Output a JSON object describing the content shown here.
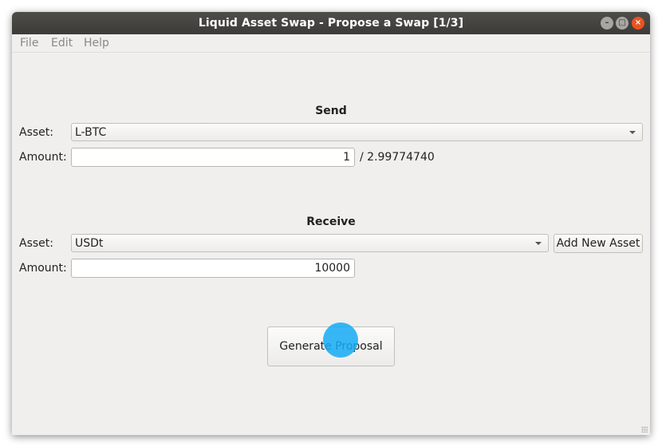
{
  "window": {
    "title": "Liquid Asset Swap - Propose a Swap [1/3]",
    "controls": {
      "minimize": "–",
      "maximize": "□",
      "close": "×"
    }
  },
  "menu": {
    "items": [
      "File",
      "Edit",
      "Help"
    ]
  },
  "send": {
    "heading": "Send",
    "asset_label": "Asset:",
    "asset_value": "L-BTC",
    "amount_label": "Amount:",
    "amount_value": "1",
    "balance": "/ 2.99774740"
  },
  "receive": {
    "heading": "Receive",
    "asset_label": "Asset:",
    "asset_value": "USDt",
    "add_asset_button": "Add New Asset",
    "amount_label": "Amount:",
    "amount_value": "10000"
  },
  "actions": {
    "generate_button": "Generate Proposal"
  },
  "colors": {
    "titlebar": "#3d3b38",
    "close_button": "#e95420",
    "cursor_highlight": "#14aaf5",
    "window_bg": "#f0efee"
  }
}
